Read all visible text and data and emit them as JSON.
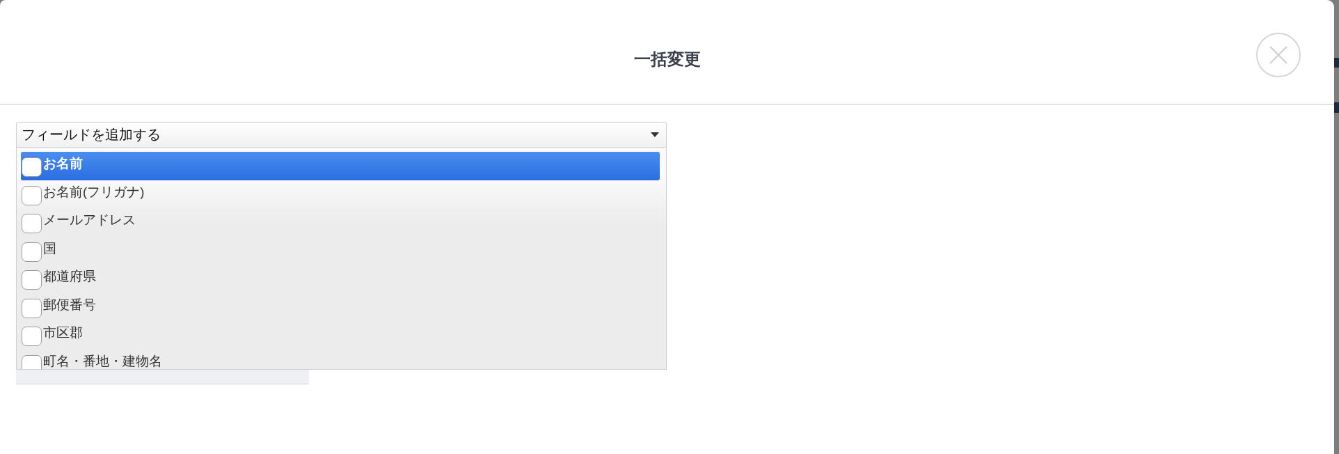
{
  "dialog": {
    "title": "一括変更"
  },
  "field_select": {
    "value": "フィールドを追加する",
    "expanded": true
  },
  "field_options": [
    {
      "label": "お名前",
      "checked": false,
      "selected": true
    },
    {
      "label": "お名前(フリガナ)",
      "checked": false,
      "selected": false
    },
    {
      "label": "メールアドレス",
      "checked": false,
      "selected": false
    },
    {
      "label": "国",
      "checked": false,
      "selected": false
    },
    {
      "label": "都道府県",
      "checked": false,
      "selected": false
    },
    {
      "label": "郵便番号",
      "checked": false,
      "selected": false
    },
    {
      "label": "市区郡",
      "checked": false,
      "selected": false
    },
    {
      "label": "町名・番地・建物名",
      "checked": false,
      "selected": false
    }
  ]
}
